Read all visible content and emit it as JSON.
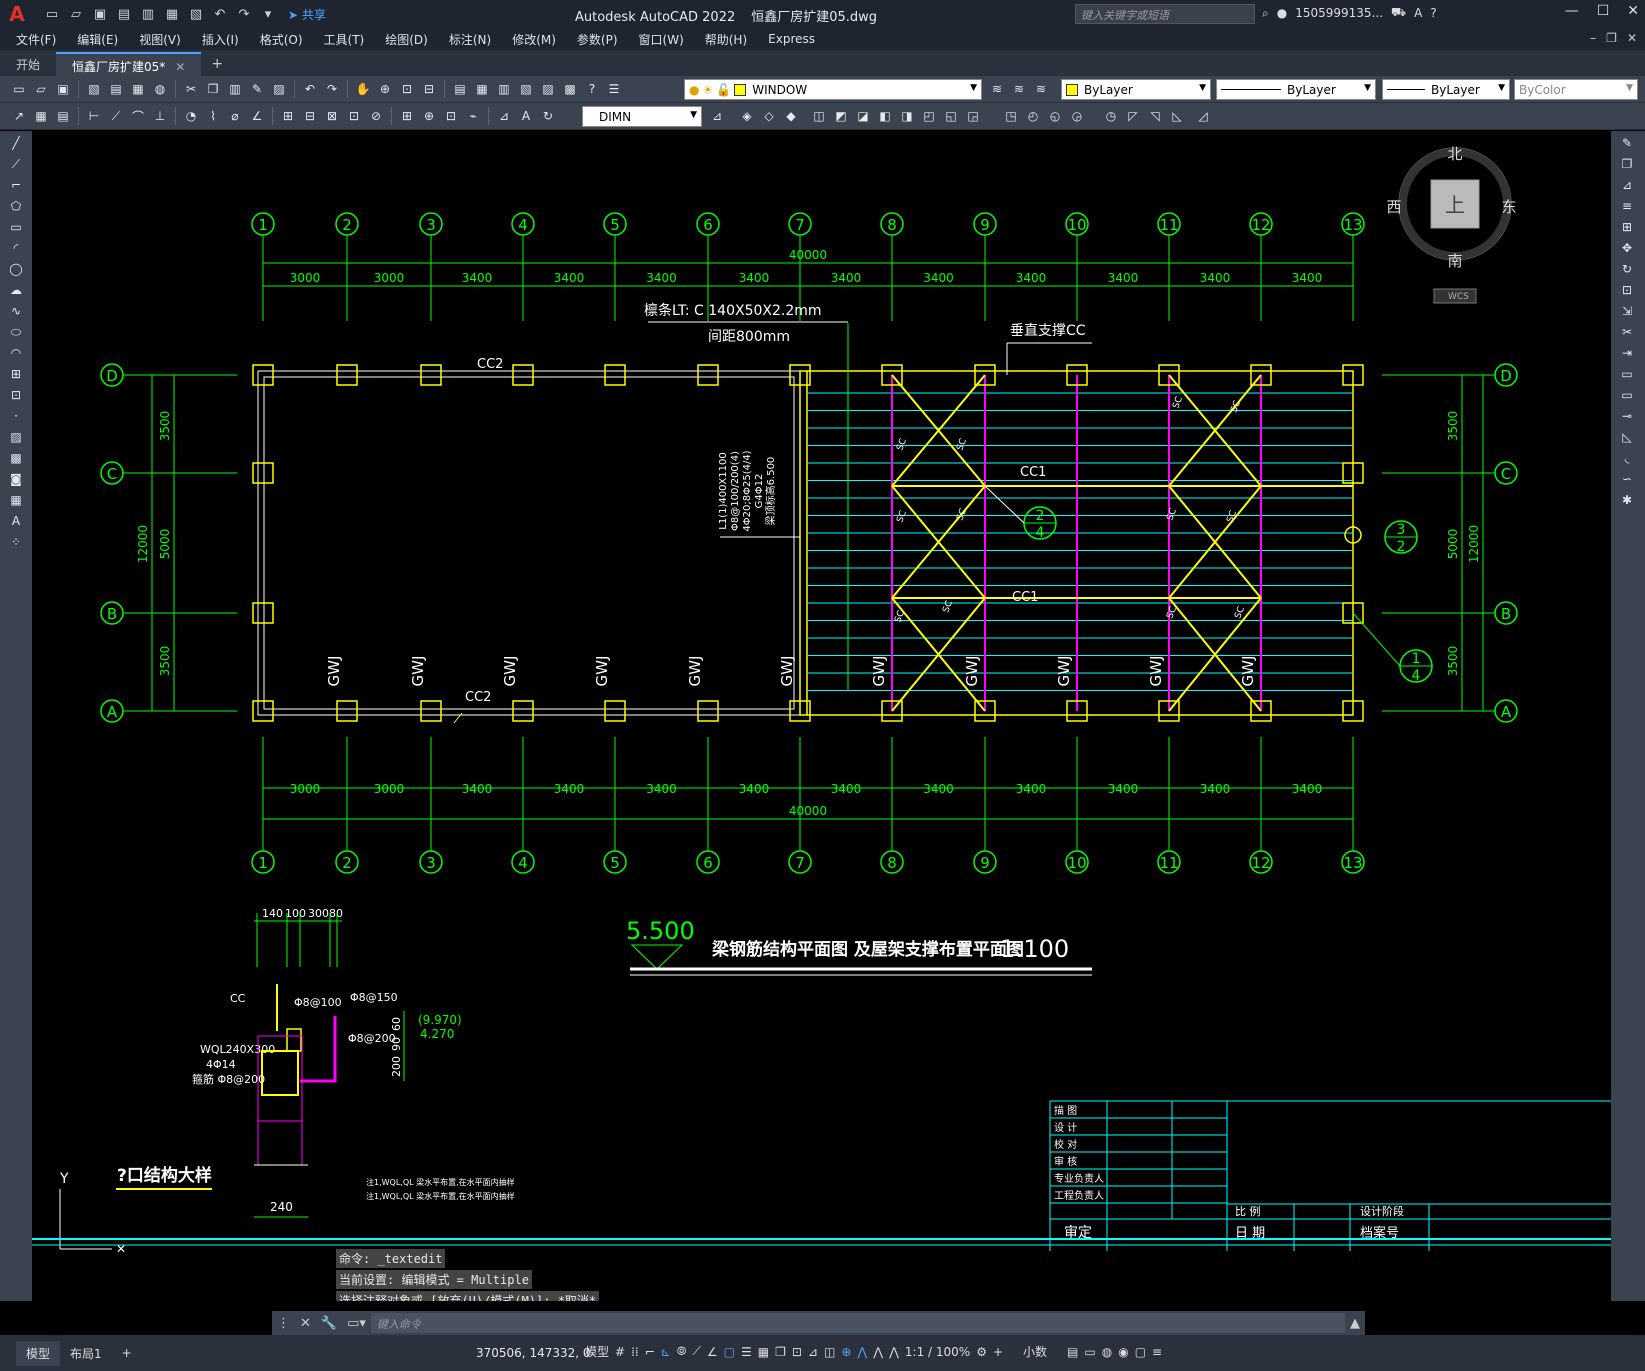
{
  "app": {
    "logo": "A",
    "title": "Autodesk AutoCAD 2022",
    "filename": "恒鑫厂房扩建05.dwg",
    "search_placeholder": "键入关键字或短语",
    "user": "1505999135...",
    "share": "共享"
  },
  "menu": [
    "文件(F)",
    "编辑(E)",
    "视图(V)",
    "插入(I)",
    "格式(O)",
    "工具(T)",
    "绘图(D)",
    "标注(N)",
    "修改(M)",
    "参数(P)",
    "窗口(W)",
    "帮助(H)",
    "Express"
  ],
  "tabs": [
    {
      "label": "开始"
    },
    {
      "label": "恒鑫厂房扩建05*"
    }
  ],
  "toolbar": {
    "layer_state": "WINDOW",
    "color": "ByLayer",
    "linetype": "ByLayer",
    "lineweight": "ByLayer",
    "plotstyle": "ByColor",
    "dimstyle": "DIMN"
  },
  "viewcube": {
    "north": "北",
    "south": "南",
    "east": "东",
    "west": "西",
    "top": "上",
    "wcs": "WCS"
  },
  "drawing": {
    "columns": [
      "1",
      "2",
      "3",
      "4",
      "5",
      "6",
      "7",
      "8",
      "9",
      "10",
      "11",
      "12",
      "13"
    ],
    "rows": [
      "D",
      "C",
      "B",
      "A"
    ],
    "spans": [
      "3000",
      "3000",
      "3400",
      "3400",
      "3400",
      "3400",
      "3400",
      "3400",
      "3400",
      "3400",
      "3400",
      "3400"
    ],
    "total": "40000",
    "row_spans_left": [
      "3500",
      "5000",
      "3500"
    ],
    "row_total": "12000",
    "purlin_label": "檩条LT: C 140X50X2.2mm",
    "purlin_spacing": "间距800mm",
    "vertical_brace": "垂直支撑CC",
    "cc2": "CC2",
    "cc1": "CC1",
    "gwj": "GWJ",
    "beam_note": [
      "L1(1)400X1100",
      "Φ8@100/200(4)",
      "4Φ20;8Φ25(4/4)",
      "G4Φ12",
      "梁顶标高6.500"
    ],
    "detail_2_4": [
      "2",
      "4"
    ],
    "detail_3_2": [
      "3",
      "2"
    ],
    "detail_1_4": [
      "1",
      "4"
    ],
    "elevation": "5.500",
    "plan_title": "梁钢筋结构平面图 及屋架支撑布置平面图",
    "plan_scale": "1:100",
    "detail_title": "?口结构大样",
    "detail_dims": [
      "140",
      "100",
      "300",
      "80"
    ],
    "detail_labels": [
      "CC",
      "Φ8@100",
      "Φ8@150",
      "WQL240X300",
      "4Φ14",
      "箍筋 Φ8@200",
      "Φ8@200",
      "(9.970)",
      "4.270",
      "240"
    ],
    "detail_vdims": [
      "60",
      "90",
      "200"
    ],
    "notes": [
      "注1,WQL,QL 梁水平布置,在水平面内抽样",
      "注1,WQL,QL 梁水平布置,在水平面内抽样"
    ],
    "titleblock": [
      "描 图",
      "设 计",
      "校 对",
      "审 核",
      "专业负责人",
      "工程负责人",
      "审定",
      "比 例",
      "日 期",
      "设计阶段",
      "档案号"
    ],
    "ucs_y": "Y"
  },
  "command": {
    "history": [
      "命令: _textedit",
      "当前设置: 编辑模式 = Multiple",
      "选择注释对象或 [放弃(U)/模式(M)]: *取消*"
    ],
    "placeholder": "键入命令"
  },
  "status": {
    "tabs": [
      "模型",
      "布局1"
    ],
    "coords": "370506, 147332, 0",
    "space": "模型",
    "scale": "1:1 / 100%",
    "units": "小数"
  },
  "colors": {
    "grid": "#00ff00",
    "yellow": "#ffff00",
    "cyan": "#00ffff",
    "magenta": "#ff00ff",
    "white": "#ffffff"
  }
}
